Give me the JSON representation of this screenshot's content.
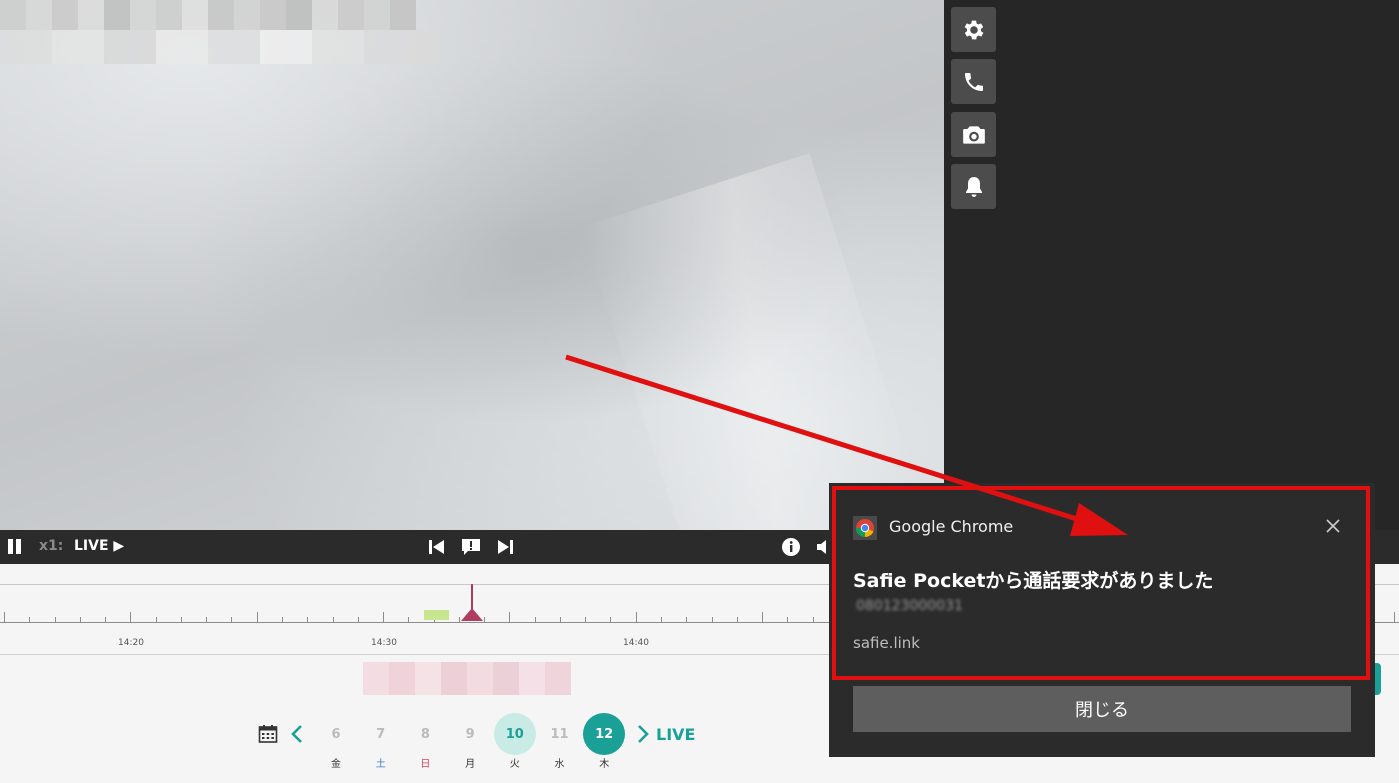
{
  "player": {
    "speed": "x1:",
    "live_label": "LIVE"
  },
  "timeline": {
    "labels": [
      "14:20",
      "14:30",
      "14:40"
    ]
  },
  "date_nav": {
    "live_label": "LIVE",
    "days": [
      {
        "num": "6",
        "wd": "金",
        "wd_color": "#333333"
      },
      {
        "num": "7",
        "wd": "土",
        "wd_color": "#3b7bd4"
      },
      {
        "num": "8",
        "wd": "日",
        "wd_color": "#e0405a"
      },
      {
        "num": "9",
        "wd": "月",
        "wd_color": "#333333"
      },
      {
        "num": "10",
        "wd": "火",
        "wd_color": "#333333"
      },
      {
        "num": "11",
        "wd": "水",
        "wd_color": "#333333"
      },
      {
        "num": "12",
        "wd": "木",
        "wd_color": "#333333"
      }
    ],
    "highlight_color": "#c8ebe6",
    "selected_color": "#1aa096",
    "accent": "#1aa096"
  },
  "notification": {
    "app_name": "Google Chrome",
    "title": "Safie Pocketから通話要求がありました",
    "body_obscured": "080123000031",
    "source": "safie.link",
    "close_label": "閉じる",
    "highlight_color": "#e01010"
  },
  "side_buttons": [
    "gear-icon",
    "phone-icon",
    "camera-icon",
    "bell-icon"
  ]
}
